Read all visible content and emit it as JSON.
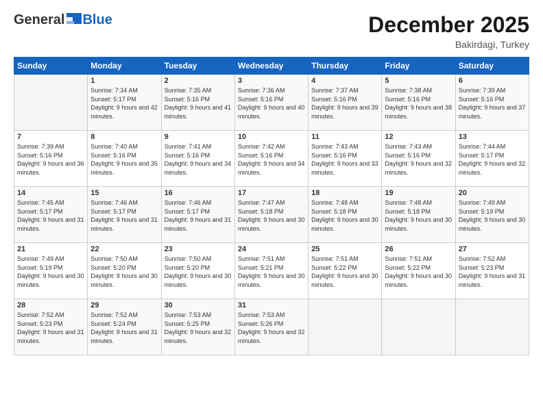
{
  "header": {
    "logo_general": "General",
    "logo_blue": "Blue",
    "month_title": "December 2025",
    "subtitle": "Bakirdagi, Turkey"
  },
  "weekdays": [
    "Sunday",
    "Monday",
    "Tuesday",
    "Wednesday",
    "Thursday",
    "Friday",
    "Saturday"
  ],
  "weeks": [
    [
      {
        "day": "",
        "sunrise": "",
        "sunset": "",
        "daylight": ""
      },
      {
        "day": "1",
        "sunrise": "Sunrise: 7:34 AM",
        "sunset": "Sunset: 5:17 PM",
        "daylight": "Daylight: 9 hours and 42 minutes."
      },
      {
        "day": "2",
        "sunrise": "Sunrise: 7:35 AM",
        "sunset": "Sunset: 5:16 PM",
        "daylight": "Daylight: 9 hours and 41 minutes."
      },
      {
        "day": "3",
        "sunrise": "Sunrise: 7:36 AM",
        "sunset": "Sunset: 5:16 PM",
        "daylight": "Daylight: 9 hours and 40 minutes."
      },
      {
        "day": "4",
        "sunrise": "Sunrise: 7:37 AM",
        "sunset": "Sunset: 5:16 PM",
        "daylight": "Daylight: 9 hours and 39 minutes."
      },
      {
        "day": "5",
        "sunrise": "Sunrise: 7:38 AM",
        "sunset": "Sunset: 5:16 PM",
        "daylight": "Daylight: 9 hours and 38 minutes."
      },
      {
        "day": "6",
        "sunrise": "Sunrise: 7:39 AM",
        "sunset": "Sunset: 5:16 PM",
        "daylight": "Daylight: 9 hours and 37 minutes."
      }
    ],
    [
      {
        "day": "7",
        "sunrise": "Sunrise: 7:39 AM",
        "sunset": "Sunset: 5:16 PM",
        "daylight": "Daylight: 9 hours and 36 minutes."
      },
      {
        "day": "8",
        "sunrise": "Sunrise: 7:40 AM",
        "sunset": "Sunset: 5:16 PM",
        "daylight": "Daylight: 9 hours and 35 minutes."
      },
      {
        "day": "9",
        "sunrise": "Sunrise: 7:41 AM",
        "sunset": "Sunset: 5:16 PM",
        "daylight": "Daylight: 9 hours and 34 minutes."
      },
      {
        "day": "10",
        "sunrise": "Sunrise: 7:42 AM",
        "sunset": "Sunset: 5:16 PM",
        "daylight": "Daylight: 9 hours and 34 minutes."
      },
      {
        "day": "11",
        "sunrise": "Sunrise: 7:43 AM",
        "sunset": "Sunset: 5:16 PM",
        "daylight": "Daylight: 9 hours and 33 minutes."
      },
      {
        "day": "12",
        "sunrise": "Sunrise: 7:43 AM",
        "sunset": "Sunset: 5:16 PM",
        "daylight": "Daylight: 9 hours and 32 minutes."
      },
      {
        "day": "13",
        "sunrise": "Sunrise: 7:44 AM",
        "sunset": "Sunset: 5:17 PM",
        "daylight": "Daylight: 9 hours and 32 minutes."
      }
    ],
    [
      {
        "day": "14",
        "sunrise": "Sunrise: 7:45 AM",
        "sunset": "Sunset: 5:17 PM",
        "daylight": "Daylight: 9 hours and 31 minutes."
      },
      {
        "day": "15",
        "sunrise": "Sunrise: 7:46 AM",
        "sunset": "Sunset: 5:17 PM",
        "daylight": "Daylight: 9 hours and 31 minutes."
      },
      {
        "day": "16",
        "sunrise": "Sunrise: 7:46 AM",
        "sunset": "Sunset: 5:17 PM",
        "daylight": "Daylight: 9 hours and 31 minutes."
      },
      {
        "day": "17",
        "sunrise": "Sunrise: 7:47 AM",
        "sunset": "Sunset: 5:18 PM",
        "daylight": "Daylight: 9 hours and 30 minutes."
      },
      {
        "day": "18",
        "sunrise": "Sunrise: 7:48 AM",
        "sunset": "Sunset: 5:18 PM",
        "daylight": "Daylight: 9 hours and 30 minutes."
      },
      {
        "day": "19",
        "sunrise": "Sunrise: 7:48 AM",
        "sunset": "Sunset: 5:18 PM",
        "daylight": "Daylight: 9 hours and 30 minutes."
      },
      {
        "day": "20",
        "sunrise": "Sunrise: 7:49 AM",
        "sunset": "Sunset: 5:19 PM",
        "daylight": "Daylight: 9 hours and 30 minutes."
      }
    ],
    [
      {
        "day": "21",
        "sunrise": "Sunrise: 7:49 AM",
        "sunset": "Sunset: 5:19 PM",
        "daylight": "Daylight: 9 hours and 30 minutes."
      },
      {
        "day": "22",
        "sunrise": "Sunrise: 7:50 AM",
        "sunset": "Sunset: 5:20 PM",
        "daylight": "Daylight: 9 hours and 30 minutes."
      },
      {
        "day": "23",
        "sunrise": "Sunrise: 7:50 AM",
        "sunset": "Sunset: 5:20 PM",
        "daylight": "Daylight: 9 hours and 30 minutes."
      },
      {
        "day": "24",
        "sunrise": "Sunrise: 7:51 AM",
        "sunset": "Sunset: 5:21 PM",
        "daylight": "Daylight: 9 hours and 30 minutes."
      },
      {
        "day": "25",
        "sunrise": "Sunrise: 7:51 AM",
        "sunset": "Sunset: 5:22 PM",
        "daylight": "Daylight: 9 hours and 30 minutes."
      },
      {
        "day": "26",
        "sunrise": "Sunrise: 7:51 AM",
        "sunset": "Sunset: 5:22 PM",
        "daylight": "Daylight: 9 hours and 30 minutes."
      },
      {
        "day": "27",
        "sunrise": "Sunrise: 7:52 AM",
        "sunset": "Sunset: 5:23 PM",
        "daylight": "Daylight: 9 hours and 31 minutes."
      }
    ],
    [
      {
        "day": "28",
        "sunrise": "Sunrise: 7:52 AM",
        "sunset": "Sunset: 5:23 PM",
        "daylight": "Daylight: 9 hours and 31 minutes."
      },
      {
        "day": "29",
        "sunrise": "Sunrise: 7:52 AM",
        "sunset": "Sunset: 5:24 PM",
        "daylight": "Daylight: 9 hours and 31 minutes."
      },
      {
        "day": "30",
        "sunrise": "Sunrise: 7:53 AM",
        "sunset": "Sunset: 5:25 PM",
        "daylight": "Daylight: 9 hours and 32 minutes."
      },
      {
        "day": "31",
        "sunrise": "Sunrise: 7:53 AM",
        "sunset": "Sunset: 5:26 PM",
        "daylight": "Daylight: 9 hours and 32 minutes."
      },
      {
        "day": "",
        "sunrise": "",
        "sunset": "",
        "daylight": ""
      },
      {
        "day": "",
        "sunrise": "",
        "sunset": "",
        "daylight": ""
      },
      {
        "day": "",
        "sunrise": "",
        "sunset": "",
        "daylight": ""
      }
    ]
  ]
}
